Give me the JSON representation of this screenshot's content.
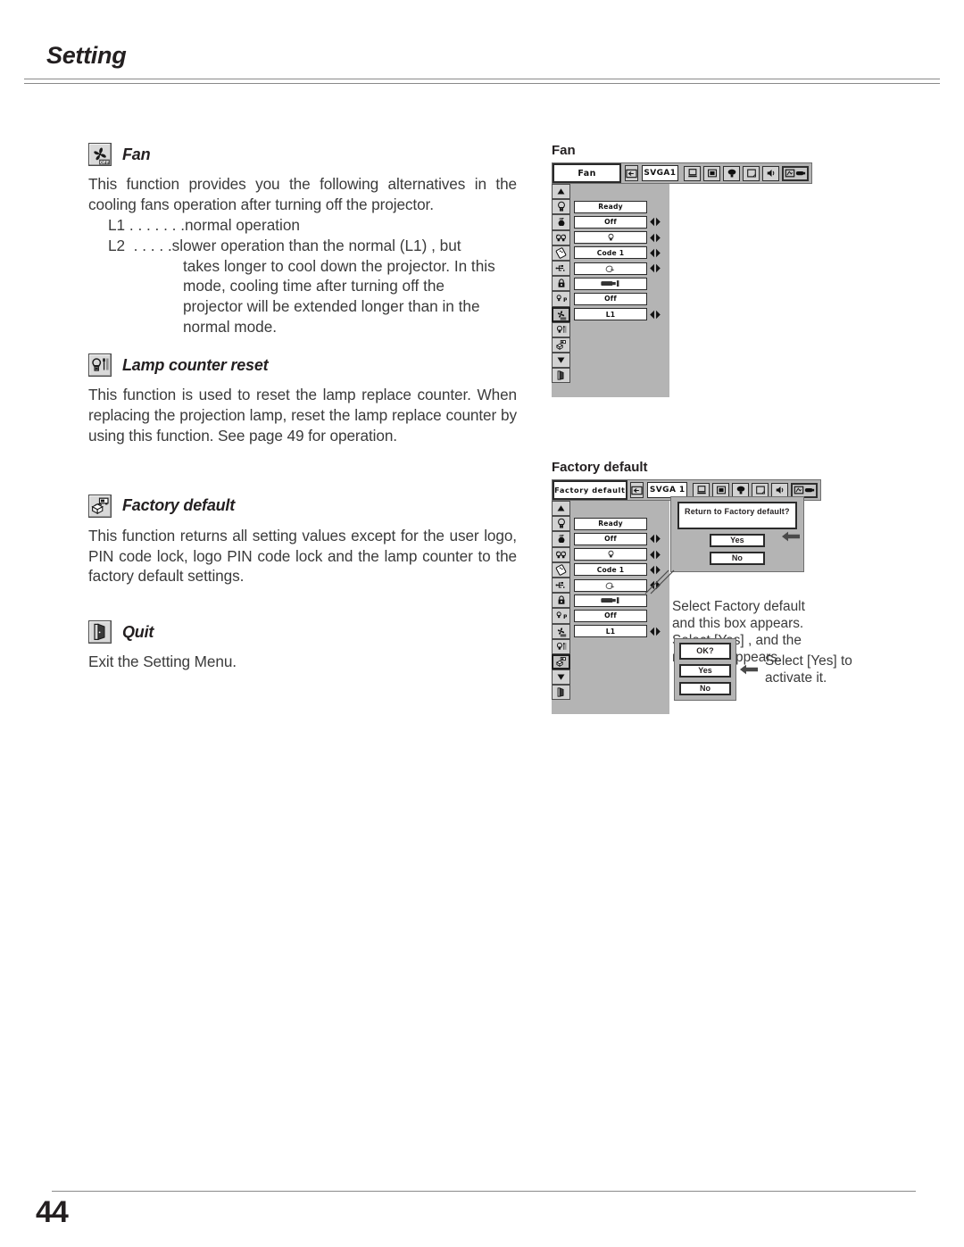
{
  "header": {
    "title": "Setting"
  },
  "footer": {
    "page_number": "44"
  },
  "sections": {
    "fan": {
      "icon": "fan-off-icon",
      "heading": "Fan",
      "paragraph": "This function provides you the following alternatives in the cooling fans operation after turning off the projector.",
      "list": [
        {
          "key": "L1 . . . . . . .",
          "text": "normal operation"
        },
        {
          "key": "L2  . . . . .",
          "text": "slower operation than the normal (L1) , but"
        }
      ],
      "continuation": [
        "takes longer to cool down the projector.  In this",
        "mode, cooling time after turning off the",
        "projector will be extended longer than in the",
        "normal mode."
      ]
    },
    "lamp_counter_reset": {
      "icon": "lamp-reset-icon",
      "heading": "Lamp counter reset",
      "paragraph": "This function is used to reset the lamp replace counter. When replacing the projection lamp, reset the lamp replace counter by using this function.  See page 49 for operation."
    },
    "factory_default": {
      "icon": "factory-default-icon",
      "heading": "Factory default",
      "paragraph": "This function returns all setting values except for the user logo,    PIN code lock, logo PIN code lock and the lamp counter to the factory default settings."
    },
    "quit": {
      "icon": "quit-door-icon",
      "heading": "Quit",
      "paragraph": "Exit the Setting Menu."
    }
  },
  "figures": {
    "fan": {
      "caption": "Fan",
      "menubar": {
        "title": "Fan",
        "back_icon": "back-arrow-icon",
        "source": "SVGA1",
        "icons": [
          "computer-icon",
          "screen-icon",
          "color-adjust-icon",
          "image-icon",
          "sound-icon",
          "setting-icon"
        ],
        "selected_icon": "setting-icon"
      },
      "scroll_up_icon": "scroll-up-icon",
      "scroll_down_icon": "scroll-down-icon",
      "rows": [
        {
          "icon": "standby-lamp-icon",
          "value": "Ready",
          "adjust": false,
          "selected": false
        },
        {
          "icon": "power-off-icon",
          "value": "Off",
          "adjust": true,
          "selected": false
        },
        {
          "icon": "lamp-mode-icon",
          "value": "lamp-glyph",
          "adjust": true,
          "selected": false
        },
        {
          "icon": "remote-code-icon",
          "value": "Code 1",
          "adjust": true,
          "selected": false
        },
        {
          "icon": "usb-icon",
          "value": "mouse-glyph",
          "adjust": true,
          "selected": false
        },
        {
          "icon": "lock-icon",
          "value": "projector-glyph",
          "adjust": false,
          "selected": false
        },
        {
          "icon": "pin-code-icon",
          "value": "Off",
          "adjust": false,
          "selected": false
        },
        {
          "icon": "fan-icon",
          "value": "L1",
          "adjust": true,
          "selected": true
        }
      ],
      "tail_icons": [
        "lamp-counter-reset-icon",
        "factory-default-icon",
        "scroll-down-icon",
        "quit-door-icon"
      ]
    },
    "factory_default": {
      "caption": "Factory default",
      "menubar": {
        "title": "Factory default",
        "back_icon": "back-arrow-icon",
        "source": "SVGA 1",
        "icons": [
          "computer-icon",
          "screen-icon",
          "color-adjust-icon",
          "image-icon",
          "sound-icon",
          "setting-icon"
        ],
        "selected_icon": "setting-icon"
      },
      "scroll_up_icon": "scroll-up-icon",
      "rows": [
        {
          "icon": "standby-lamp-icon",
          "value": "Ready",
          "adjust": false,
          "selected": false
        },
        {
          "icon": "power-off-icon",
          "value": "Off",
          "adjust": true,
          "selected": false
        },
        {
          "icon": "lamp-mode-icon",
          "value": "lamp-glyph",
          "adjust": true,
          "selected": false
        },
        {
          "icon": "remote-code-icon",
          "value": "Code 1",
          "adjust": true,
          "selected": false
        },
        {
          "icon": "usb-icon",
          "value": "mouse-glyph",
          "adjust": true,
          "selected": false
        },
        {
          "icon": "lock-icon",
          "value": "projector-glyph",
          "adjust": false,
          "selected": false
        },
        {
          "icon": "pin-code-icon",
          "value": "Off",
          "adjust": false,
          "selected": false
        },
        {
          "icon": "fan-icon",
          "value": "L1",
          "adjust": true,
          "selected": false
        }
      ],
      "tail_icons": [
        "lamp-counter-reset-icon",
        "factory-default-icon",
        "scroll-down-icon",
        "quit-door-icon"
      ],
      "selected_tail_icon": "factory-default-icon",
      "dialog_confirm": {
        "message": "Return to Factory default?",
        "yes_label": "Yes",
        "no_label": "No",
        "arrow_icon": "arrow-left-icon"
      },
      "note_confirm": [
        "Select Factory default",
        "and this box appears.",
        "Select [Yes] , and the",
        "next box appears."
      ],
      "dialog_ok": {
        "message": "OK?",
        "yes_label": "Yes",
        "no_label": "No",
        "arrow_icon": "arrow-left-icon"
      },
      "note_ok": [
        "Select [Yes] to",
        "activate it."
      ]
    }
  }
}
